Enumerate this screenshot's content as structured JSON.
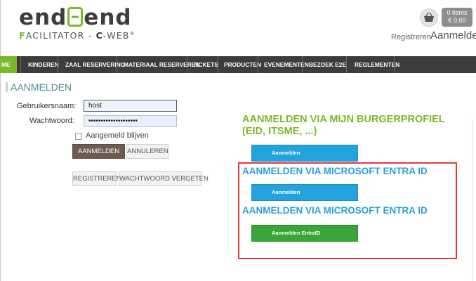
{
  "logo": {
    "part1": "end",
    "part2": "end",
    "sub_f": "F",
    "sub_acilitator": "ACILITATOR - ",
    "sub_c": "C",
    "sub_web": "-WEB",
    "sub_mark": "®"
  },
  "cart": {
    "items": "0 items",
    "amount": "€ 0,00"
  },
  "header": {
    "register_link": "Registreren",
    "login_link": "Aanmelden"
  },
  "nav": [
    {
      "label": "ME"
    },
    {
      "label": "KINDEREN"
    },
    {
      "label": "ZAAL RESERVERING"
    },
    {
      "label": "MATERIAAL RESERVEREN"
    },
    {
      "label": "TICKETS"
    },
    {
      "label": "PRODUCTEN"
    },
    {
      "label": "EVENEMENTEN"
    },
    {
      "label": "BEZOEK E2E"
    },
    {
      "label": "REGLEMENTEN"
    }
  ],
  "login": {
    "title": "AANMELDEN",
    "username_label": "Gebruikersnaam:",
    "username_value": "host",
    "password_label": "Wachtwoord:",
    "password_value": "••••••••••••••••••••",
    "remember_label": "Aangemeld blijven",
    "login_button": "AANMELDEN",
    "cancel_button": "ANNULEREN",
    "register_button": "REGISTREREN",
    "forgot_button": "WACHTWOORD VERGETEN"
  },
  "external": {
    "burgerprofiel_heading": "AANMELDEN VIA MIJN BURGERPROFIEL (EID, ITSME, ...)",
    "burgerprofiel_button": "Aanmelden",
    "entra_heading_1": "AANMELDEN VIA MICROSOFT ENTRA ID",
    "entra_button_1": "Aanmelden",
    "entra_heading_2": "AANMELDEN VIA MICROSOFT ENTRA ID",
    "entra_button_2": "Aanmelden EntraID"
  },
  "colors": {
    "brand_green": "#7ab929",
    "brand_blue": "#29a1d8",
    "nav_bg": "#3c3c3c",
    "highlight_red": "#e53935"
  }
}
